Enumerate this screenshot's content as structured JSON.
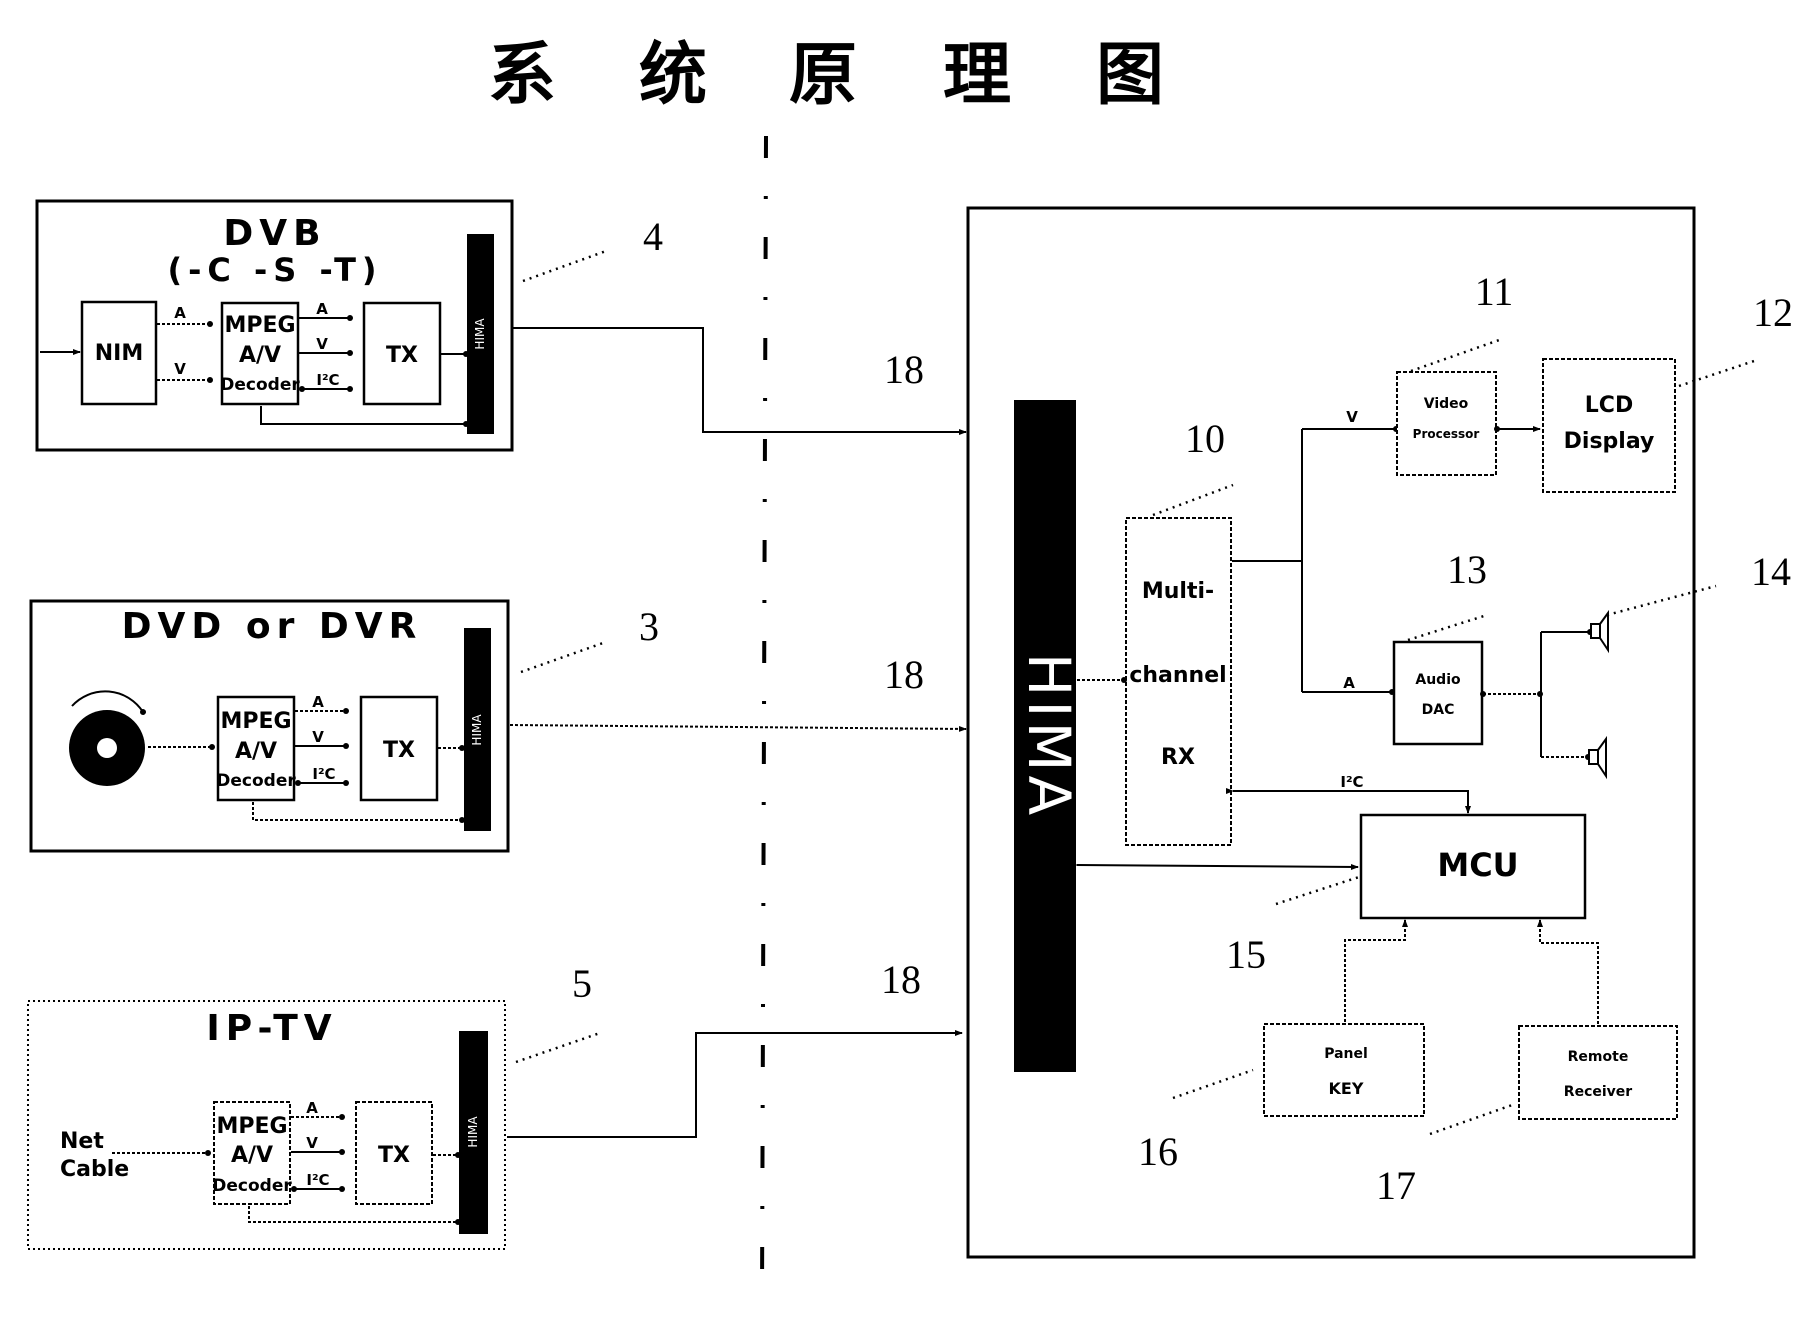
{
  "title": {
    "chars": [
      "系",
      "统",
      "原",
      "理",
      "图"
    ],
    "text": "系统原理图"
  },
  "sources": {
    "dvb": {
      "title_line1": "DVB",
      "title_line2": "(-C -S -T)",
      "nim_label": "NIM",
      "decoder_line1": "MPEG",
      "decoder_line2": "A/V",
      "decoder_line3": "Decoder",
      "tx_label": "TX",
      "hima_label": "HIMA",
      "ref_number": "4",
      "signals": {
        "nim_a": "A",
        "nim_v": "V",
        "out_a": "A",
        "out_v": "V",
        "out_i2c": "I²C"
      }
    },
    "dvd": {
      "title": "DVD or DVR",
      "decoder_line1": "MPEG",
      "decoder_line2": "A/V",
      "decoder_line3": "Decoder",
      "tx_label": "TX",
      "hima_label": "HIMA",
      "ref_number": "3",
      "signals": {
        "out_a": "A",
        "out_v": "V",
        "out_i2c": "I²C"
      }
    },
    "iptv": {
      "title": "IP-TV",
      "input_line1": "Net",
      "input_line2": "Cable",
      "decoder_line1": "MPEG",
      "decoder_line2": "A/V",
      "decoder_line3": "Decoder",
      "tx_label": "TX",
      "hima_label": "HIMA",
      "ref_number": "5",
      "signals": {
        "out_a": "A",
        "out_v": "V",
        "out_i2c": "I²C"
      }
    }
  },
  "link_labels": [
    "18",
    "18",
    "18"
  ],
  "display_unit": {
    "hima_label": "HIMA",
    "rx_line1": "Multi-",
    "rx_line2": "channel",
    "rx_line3": "RX",
    "video_proc_line1": "Video",
    "video_proc_line2": "Processor",
    "lcd_line1": "LCD",
    "lcd_line2": "Display",
    "audio_dac_line1": "Audio",
    "audio_dac_line2": "DAC",
    "mcu_label": "MCU",
    "panel_key_line1": "Panel",
    "panel_key_line2": "KEY",
    "remote_line1": "Remote",
    "remote_line2": "Receiver",
    "signals": {
      "v": "V",
      "a": "A",
      "i2c": "I²C"
    },
    "ref_numbers": {
      "rx": "10",
      "video_processor": "11",
      "lcd": "12",
      "audio_dac": "13",
      "speakers": "14",
      "mcu": "15",
      "panel_key": "16",
      "remote": "17"
    }
  }
}
